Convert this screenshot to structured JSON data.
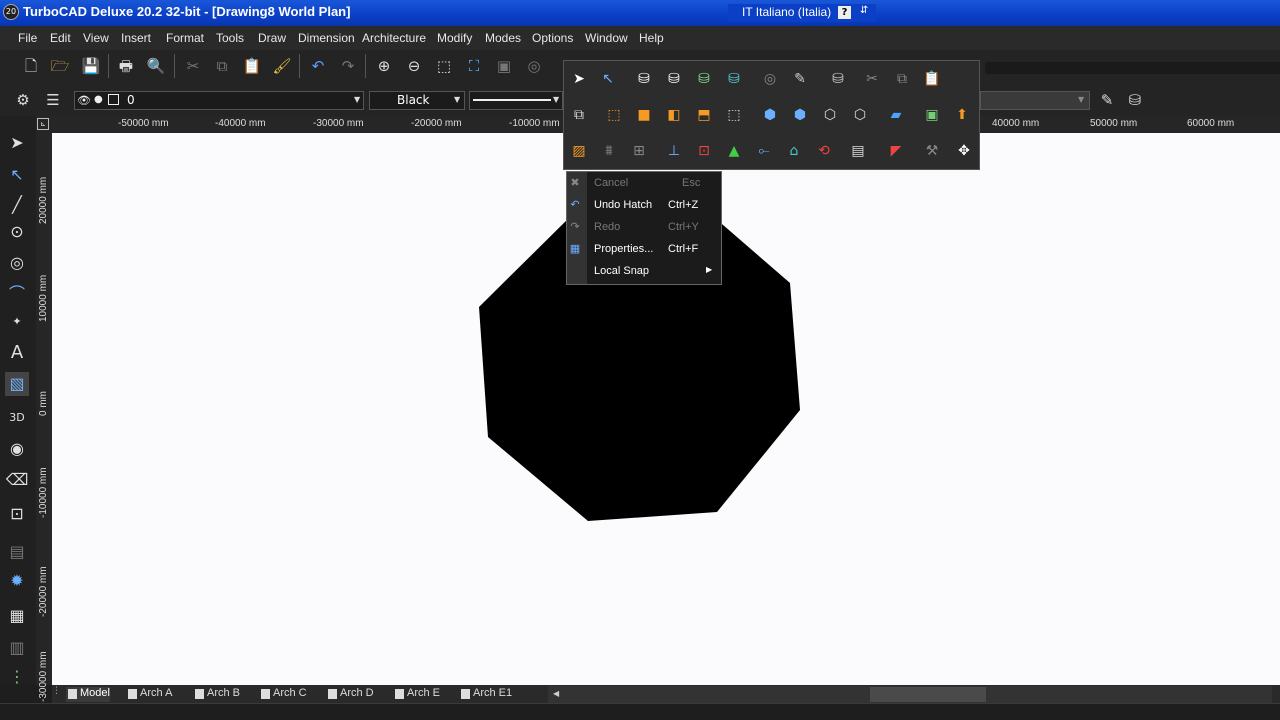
{
  "window": {
    "title": "TurboCAD Deluxe 20.2 32-bit - [Drawing8 World Plan]",
    "language": "IT Italiano (Italia)",
    "help_glyph": "?"
  },
  "menu": [
    "File",
    "Edit",
    "View",
    "Insert",
    "Format",
    "Tools",
    "Draw",
    "Dimension",
    "Architecture",
    "Modify",
    "Modes",
    "Options",
    "Window",
    "Help"
  ],
  "properties_bar": {
    "layer": "0",
    "color": "Black"
  },
  "ruler": {
    "horizontal": [
      "-50000 mm",
      "-40000 mm",
      "-30000 mm",
      "-20000 mm",
      "-10000 mm",
      "40000 mm",
      "50000 mm",
      "60000 mm"
    ],
    "vertical": [
      "20000 mm",
      "10000 mm",
      "0 mm",
      "-10000 mm",
      "-20000 mm",
      "-30000 mm"
    ]
  },
  "context_menu": {
    "items": [
      {
        "label": "Cancel",
        "shortcut": "Esc",
        "enabled": false,
        "icon": "x-icon"
      },
      {
        "label": "Undo Hatch",
        "shortcut": "Ctrl+Z",
        "enabled": true,
        "icon": "undo-icon"
      },
      {
        "label": "Redo",
        "shortcut": "Ctrl+Y",
        "enabled": false,
        "icon": "redo-icon"
      },
      {
        "label": "Properties...",
        "shortcut": "Ctrl+F",
        "enabled": true,
        "icon": "properties-icon"
      },
      {
        "label": "Local Snap",
        "shortcut": "",
        "enabled": true,
        "submenu": true
      }
    ]
  },
  "tabs": [
    "Model",
    "Arch A",
    "Arch B",
    "Arch C",
    "Arch D",
    "Arch E",
    "Arch E1"
  ],
  "colors": {
    "title_bar": "#0a3fc6",
    "canvas": "#fbfbfd",
    "shape": "#000000",
    "ui_dark": "#242424"
  }
}
